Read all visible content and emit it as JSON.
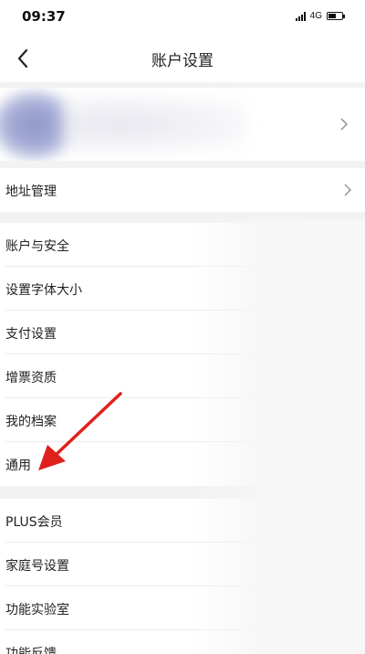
{
  "status_bar": {
    "time": "09:37",
    "network": "4G",
    "battery_level": 0.55
  },
  "nav": {
    "title": "账户设置",
    "back_icon": "chevron-left-icon"
  },
  "profile": {
    "chevron_icon": "chevron-right-icon"
  },
  "address": {
    "label": "地址管理",
    "chevron_icon": "chevron-right-icon"
  },
  "group1": [
    {
      "label": "账户与安全"
    },
    {
      "label": "设置字体大小"
    },
    {
      "label": "支付设置"
    },
    {
      "label": "增票资质"
    },
    {
      "label": "我的档案"
    },
    {
      "label": "通用"
    }
  ],
  "group2": [
    {
      "label": "PLUS会员"
    },
    {
      "label": "家庭号设置"
    },
    {
      "label": "功能实验室"
    },
    {
      "label": "功能反馈"
    }
  ],
  "annotation": {
    "arrow_color": "#e0201c",
    "arrow_icon": "red-arrow-icon"
  }
}
